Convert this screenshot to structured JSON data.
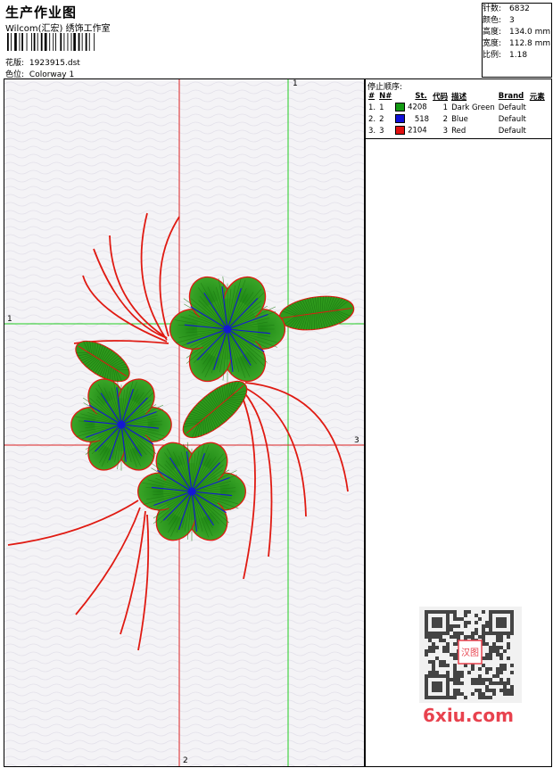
{
  "header": {
    "title": "生产作业图",
    "subtitle": "Wilcom(汇宏) 绣饰工作室",
    "design_file_label": "花版:",
    "design_file": "1923915.dst",
    "colorway_label": "色位:",
    "colorway": "Colorway 1"
  },
  "stats": [
    {
      "label": "针数:",
      "value": "6832"
    },
    {
      "label": "颜色:",
      "value": "3"
    },
    {
      "label": "高度:",
      "value": "134.0 mm"
    },
    {
      "label": "宽度:",
      "value": "112.8 mm"
    },
    {
      "label": "比例:",
      "value": "1.18"
    }
  ],
  "stop_sequence": {
    "title": "停止顺序:",
    "columns": [
      "#",
      "N#",
      "St.",
      "代码",
      "描述",
      "Brand",
      "元素"
    ],
    "rows": [
      {
        "num": "1.",
        "n": "1",
        "color": "#129a12",
        "stitches": "4208",
        "code": "1",
        "desc": "Dark Green",
        "brand": "Default"
      },
      {
        "num": "2.",
        "n": "2",
        "color": "#1010d8",
        "stitches": "518",
        "code": "2",
        "desc": "Blue",
        "brand": "Default"
      },
      {
        "num": "3.",
        "n": "3",
        "color": "#e01010",
        "stitches": "2104",
        "code": "3",
        "desc": "Red",
        "brand": "Default"
      }
    ]
  },
  "axis_labels": {
    "green_vertical": "1",
    "green_horizontal": "1",
    "red_horizontal": "3",
    "red_vertical": "2"
  },
  "watermark": {
    "stamp": "汉图",
    "site": "6xiu.com"
  },
  "colors": {
    "thread_green": "#2e9a1c",
    "thread_dark_green": "#1d7a12",
    "thread_blue": "#1418d4",
    "thread_red": "#e01a12",
    "guide_green": "#22cc22",
    "guide_red": "#dd2222"
  }
}
